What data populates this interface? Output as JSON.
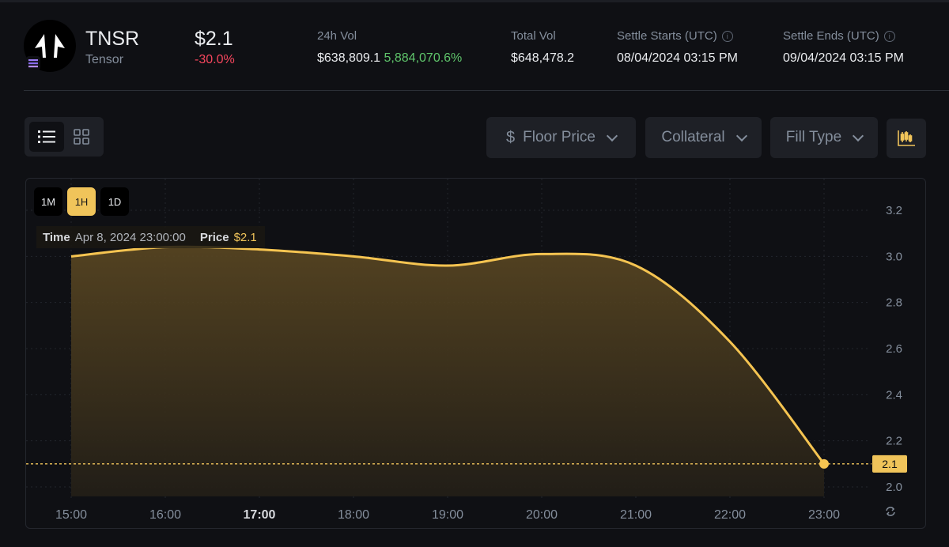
{
  "header": {
    "symbol": "TNSR",
    "name": "Tensor",
    "price": "$2.1",
    "change": "-30.0%",
    "stats": [
      {
        "label": "24h Vol",
        "value": "$638,809.1",
        "extra": "5,884,070.6%"
      },
      {
        "label": "Total Vol",
        "value": "$648,478.2"
      },
      {
        "label": "Settle Starts (UTC)",
        "value": "08/04/2024 03:15 PM",
        "info": true
      },
      {
        "label": "Settle Ends (UTC)",
        "value": "09/04/2024 03:15 PM",
        "info": true
      }
    ]
  },
  "toolbar": {
    "view_icons": [
      "list-icon",
      "grid-icon"
    ],
    "dropdowns": [
      {
        "label": "Floor Price",
        "icon": "dollar-icon"
      },
      {
        "label": "Collateral"
      },
      {
        "label": "Fill Type"
      }
    ],
    "chart_type_icon": "candlestick-icon"
  },
  "timeframes": [
    {
      "label": "1M"
    },
    {
      "label": "1H",
      "active": true
    },
    {
      "label": "1D"
    }
  ],
  "tooltip": {
    "time_label": "Time",
    "time": "Apr 8, 2024 23:00:00",
    "price_label": "Price",
    "price": "$2.1"
  },
  "colors": {
    "accent": "#f0c45a",
    "negative": "#f6465d",
    "positive": "#5fc56b"
  },
  "chart_data": {
    "type": "area",
    "x": [
      "15:00",
      "16:00",
      "17:00",
      "18:00",
      "19:00",
      "20:00",
      "21:00",
      "22:00",
      "23:00"
    ],
    "highlight_x": "17:00",
    "values": [
      3.0,
      3.04,
      3.03,
      3.0,
      2.96,
      3.01,
      2.96,
      2.63,
      2.1
    ],
    "yticks": [
      "3.2",
      "3.0",
      "2.8",
      "2.6",
      "2.4",
      "2.2",
      "2.0"
    ],
    "ylim": [
      2.0,
      3.2
    ],
    "last_value_label": "2.1",
    "grid": true
  }
}
